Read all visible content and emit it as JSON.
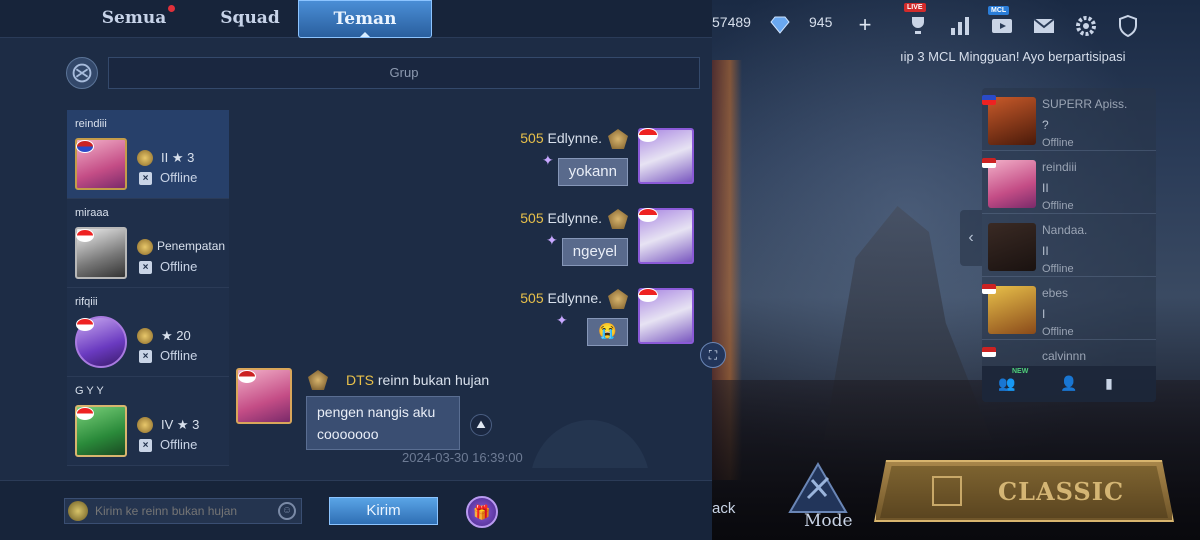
{
  "tabs": [
    {
      "label": "Semua"
    },
    {
      "label": "Squad"
    },
    {
      "label": "Teman"
    }
  ],
  "group": {
    "label": "Grup"
  },
  "friends": [
    {
      "name": "reindiii",
      "rank": "II ★ 3",
      "status": "Offline"
    },
    {
      "name": "miraaa",
      "rank": "Penempatan",
      "status": "Offline"
    },
    {
      "name": "rifqiii",
      "rank": "★ 20",
      "status": "Offline"
    },
    {
      "name": "G Y Y",
      "rank": "IV ★ 3",
      "status": "Offline"
    }
  ],
  "messages": [
    {
      "level": "505",
      "sender": "Edlynne.",
      "text": "yokann"
    },
    {
      "level": "505",
      "sender": "Edlynne.",
      "text": "ngeyel"
    },
    {
      "level": "505",
      "sender": "Edlynne.",
      "text": "😭"
    },
    {
      "tag": "DTS",
      "sender": "reinn bukan hujan",
      "text": "pengen nangis aku cooooooo",
      "time": "2024-03-30 16:39:00"
    }
  ],
  "input": {
    "placeholder": "Kirim ke reinn bukan hujan",
    "send_label": "Kirim"
  },
  "topbar": {
    "currency_a": "57489",
    "currency_b": "945",
    "live_badge": "LIVE",
    "mcl_badge": "MCL"
  },
  "marquee": "ıip 3 MCL Mingguan! Ayo berpartisipasi",
  "right_friends": [
    {
      "name": "SUPERR Apiss.",
      "rank": "?",
      "status": "Offline"
    },
    {
      "name": "reindiii",
      "rank": "II",
      "status": "Offline"
    },
    {
      "name": "Nandaa.",
      "rank": "II",
      "status": "Offline"
    },
    {
      "name": "ebes",
      "rank": "I",
      "status": "Offline"
    },
    {
      "name": "calvinnn",
      "rank": "",
      "status": ""
    }
  ],
  "right_footer": {
    "new_badge": "NEW"
  },
  "bottom": {
    "back_label": "ack",
    "mode_label": "Mode",
    "classic_label": "CLASSIC"
  },
  "colors": {
    "accent": "#4a8ed6",
    "gold": "#e8c04a",
    "panel": "#1d2c45"
  },
  "icons": [
    "group-icon",
    "rank-badge-icon",
    "offline-x-icon",
    "translate-icon",
    "screenshot-icon",
    "emoji-icon",
    "gift-icon",
    "diamond-icon",
    "plus-icon",
    "trophy-icon",
    "stats-icon",
    "video-icon",
    "mail-icon",
    "gear-icon",
    "add-friend-icon",
    "invite-icon",
    "block-icon"
  ]
}
